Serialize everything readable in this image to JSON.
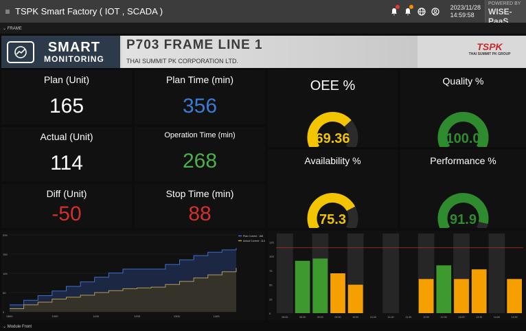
{
  "topbar": {
    "title": "TSPK Smart Factory ( IOT , SCADA )",
    "date": "2023/11/28",
    "time": "14:59:58",
    "powered_by": "POWERED BY",
    "brand": "WISE-PaaS",
    "icons": [
      "bell-icon",
      "bell-icon",
      "globe-icon",
      "user-icon"
    ],
    "colors": {
      "alert_red": "#e53935",
      "alert_orange": "#fb8c00"
    }
  },
  "frame_label": "⌄ FRAME",
  "header": {
    "logo_line1": "SMART",
    "logo_line2": "MONITORING",
    "line_title": "P703 FRAME LINE 1",
    "corporation": "THAI SUMMIT PK CORPORATION LTD.",
    "group_logo": "TSPK",
    "group_name": "THAI SUMMIT PK GROUP"
  },
  "metrics": {
    "plan": {
      "label": "Plan (Unit)",
      "value": "165"
    },
    "plan_time": {
      "label": "Plan Time (min)",
      "value": "356"
    },
    "actual": {
      "label": "Actual (Unit)",
      "value": "114"
    },
    "operation_time": {
      "label": "Operation Time (min)",
      "value": "268"
    },
    "diff": {
      "label": "Diff (Unit)",
      "value": "-50"
    },
    "stop_time": {
      "label": "Stop Time (min)",
      "value": "88"
    }
  },
  "gauges": {
    "oee": {
      "label": "OEE %",
      "value": "69.36",
      "fraction": 0.6936,
      "color": "#f2c500"
    },
    "quality": {
      "label": "Quality %",
      "value": "100.0",
      "fraction": 1.0,
      "color": "#2e8b2e"
    },
    "availability": {
      "label": "Availability %",
      "value": "75.3",
      "fraction": 0.753,
      "color": "#f2c500"
    },
    "performance": {
      "label": "Performance %",
      "value": "91.9",
      "fraction": 0.919,
      "color": "#2e8b2e"
    }
  },
  "colors": {
    "white": "#ffffff",
    "blue": "#3a7bd5",
    "green": "#4caf50",
    "red": "#d32f2f"
  },
  "bottom_label": "⌄ Module Front",
  "chart_data": [
    {
      "type": "area",
      "legend_position": "top-right",
      "legend": [
        "Plan Current : 166",
        "Actual Current : 114"
      ],
      "x_ticks": [
        "0800",
        "1000",
        "1100",
        "1200",
        "1300",
        "1400"
      ],
      "y_ticks": [
        "0",
        "50",
        "100",
        "150",
        "200"
      ],
      "ylim": [
        0,
        200
      ],
      "x": [
        8.0,
        8.5,
        9.0,
        9.5,
        10.0,
        10.5,
        11.0,
        11.5,
        12.0,
        12.5,
        13.0,
        13.5,
        14.0,
        14.5,
        15.0,
        15.5,
        16.0
      ],
      "series": [
        {
          "name": "Plan Current : 166",
          "color": "#3a6fd0",
          "values": [
            18,
            30,
            42,
            54,
            66,
            78,
            90,
            101,
            111,
            111,
            111,
            123,
            135,
            146,
            155,
            161,
            166
          ]
        },
        {
          "name": "Actual Current : 114",
          "color": "#b49a55",
          "values": [
            8,
            18,
            25,
            33,
            38,
            43,
            50,
            55,
            60,
            62,
            64,
            71,
            79,
            88,
            96,
            104,
            114
          ]
        }
      ]
    },
    {
      "type": "bar",
      "target_line": 115,
      "ylim": [
        0,
        140
      ],
      "y_ticks": [
        "0",
        "25",
        "50",
        "75",
        "100",
        "125"
      ],
      "categories": [
        "08:00",
        "08:30",
        "09:00",
        "09:30",
        "10:00",
        "10:30",
        "11:00",
        "11:30",
        "12:00",
        "12:30",
        "13:00",
        "13:30",
        "14:00",
        "14:30"
      ],
      "values": [
        0,
        0,
        0,
        0,
        0,
        0,
        0,
        0,
        0,
        0,
        0,
        0,
        0,
        0
      ],
      "bars": [
        {
          "label": "08:00",
          "value": 0,
          "color": "none"
        },
        {
          "label": "08:30",
          "value": 92,
          "color": "#3e9a2f"
        },
        {
          "label": "09:00",
          "value": 96,
          "color": "#3e9a2f"
        },
        {
          "label": "09:30",
          "value": 70,
          "color": "#f5a000"
        },
        {
          "label": "10:00",
          "value": 50,
          "color": "#f5a000"
        },
        {
          "label": "10:30",
          "value": 0,
          "color": "none"
        },
        {
          "label": "11:00",
          "value": 0,
          "color": "none"
        },
        {
          "label": "11:30",
          "value": 0,
          "color": "none"
        },
        {
          "label": "12:00",
          "value": 60,
          "color": "#f5a000"
        },
        {
          "label": "12:30",
          "value": 84,
          "color": "#3e9a2f"
        },
        {
          "label": "13:00",
          "value": 60,
          "color": "#f5a000"
        },
        {
          "label": "13:30",
          "value": 77,
          "color": "#f5a000"
        },
        {
          "label": "14:00",
          "value": 0,
          "color": "none"
        },
        {
          "label": "14:30",
          "value": 60,
          "color": "#f5a000"
        }
      ]
    }
  ]
}
